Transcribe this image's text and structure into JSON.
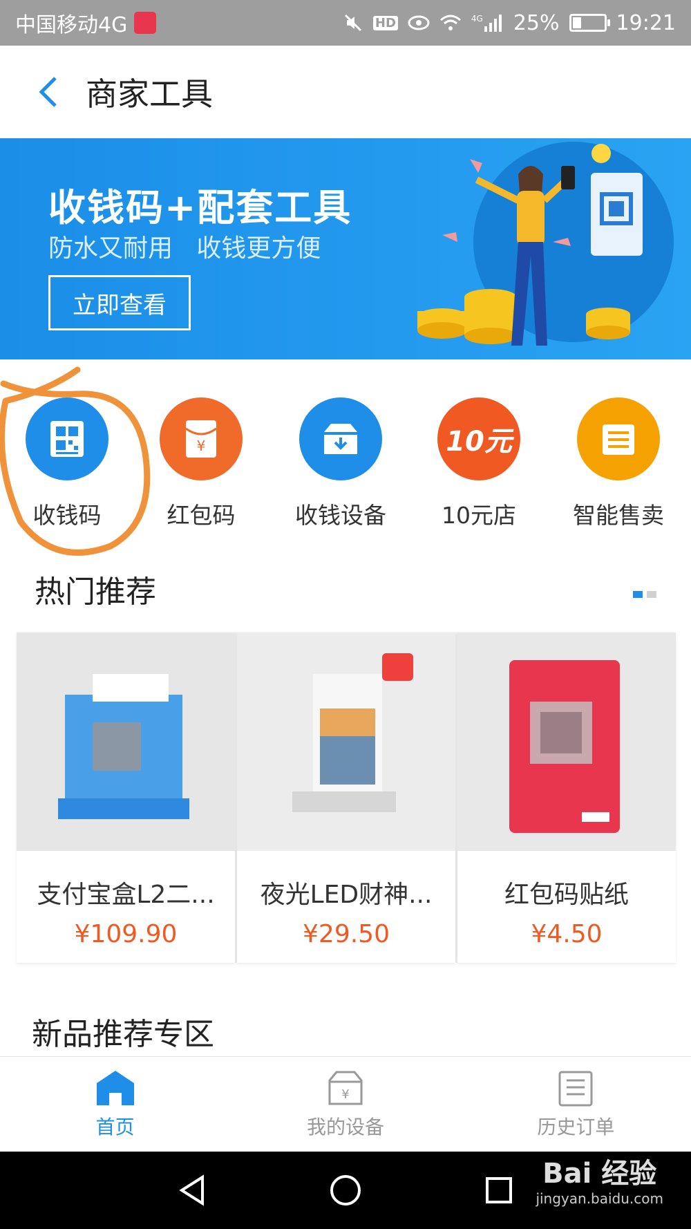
{
  "status_bar": {
    "carrier": "中国移动4G",
    "hd": "HD",
    "network": "4G",
    "battery": "25%",
    "battery_level": 0.25,
    "time": "19:21"
  },
  "header": {
    "title": "商家工具"
  },
  "banner": {
    "title": "收钱码+配套工具",
    "subtitle": "防水又耐用   收钱更方便",
    "button": "立即查看"
  },
  "quick_tools": [
    {
      "label": "收钱码",
      "icon": "qr-code-icon",
      "color": "#1e8ee9"
    },
    {
      "label": "红包码",
      "icon": "red-envelope-icon",
      "color": "#f06a2a"
    },
    {
      "label": "收钱设备",
      "icon": "device-box-icon",
      "color": "#1e8ee9"
    },
    {
      "label": "10元店",
      "icon": "ten-yuan-icon",
      "icon_text": "10元",
      "color": "#f05a22"
    },
    {
      "label": "智能售卖",
      "icon": "vending-icon",
      "color": "#f5a100"
    }
  ],
  "hot": {
    "title": "热门推荐",
    "products": [
      {
        "name": "支付宝盒L2二...",
        "price": "¥109.90"
      },
      {
        "name": "夜光LED财神...",
        "price": "¥29.50"
      },
      {
        "name": "红包码贴纸",
        "price": "¥4.50"
      }
    ]
  },
  "new_section": {
    "title": "新品推荐专区"
  },
  "bottom_nav": [
    {
      "label": "首页",
      "icon": "home-icon",
      "active": true
    },
    {
      "label": "我的设备",
      "icon": "my-device-icon",
      "active": false
    },
    {
      "label": "历史订单",
      "icon": "order-list-icon",
      "active": false
    }
  ],
  "watermark": {
    "brand": "Bai 经验",
    "url": "jingyan.baidu.com"
  },
  "colors": {
    "accent": "#1e8ee9",
    "price": "#f05a22",
    "annotation": "#f0923a"
  }
}
